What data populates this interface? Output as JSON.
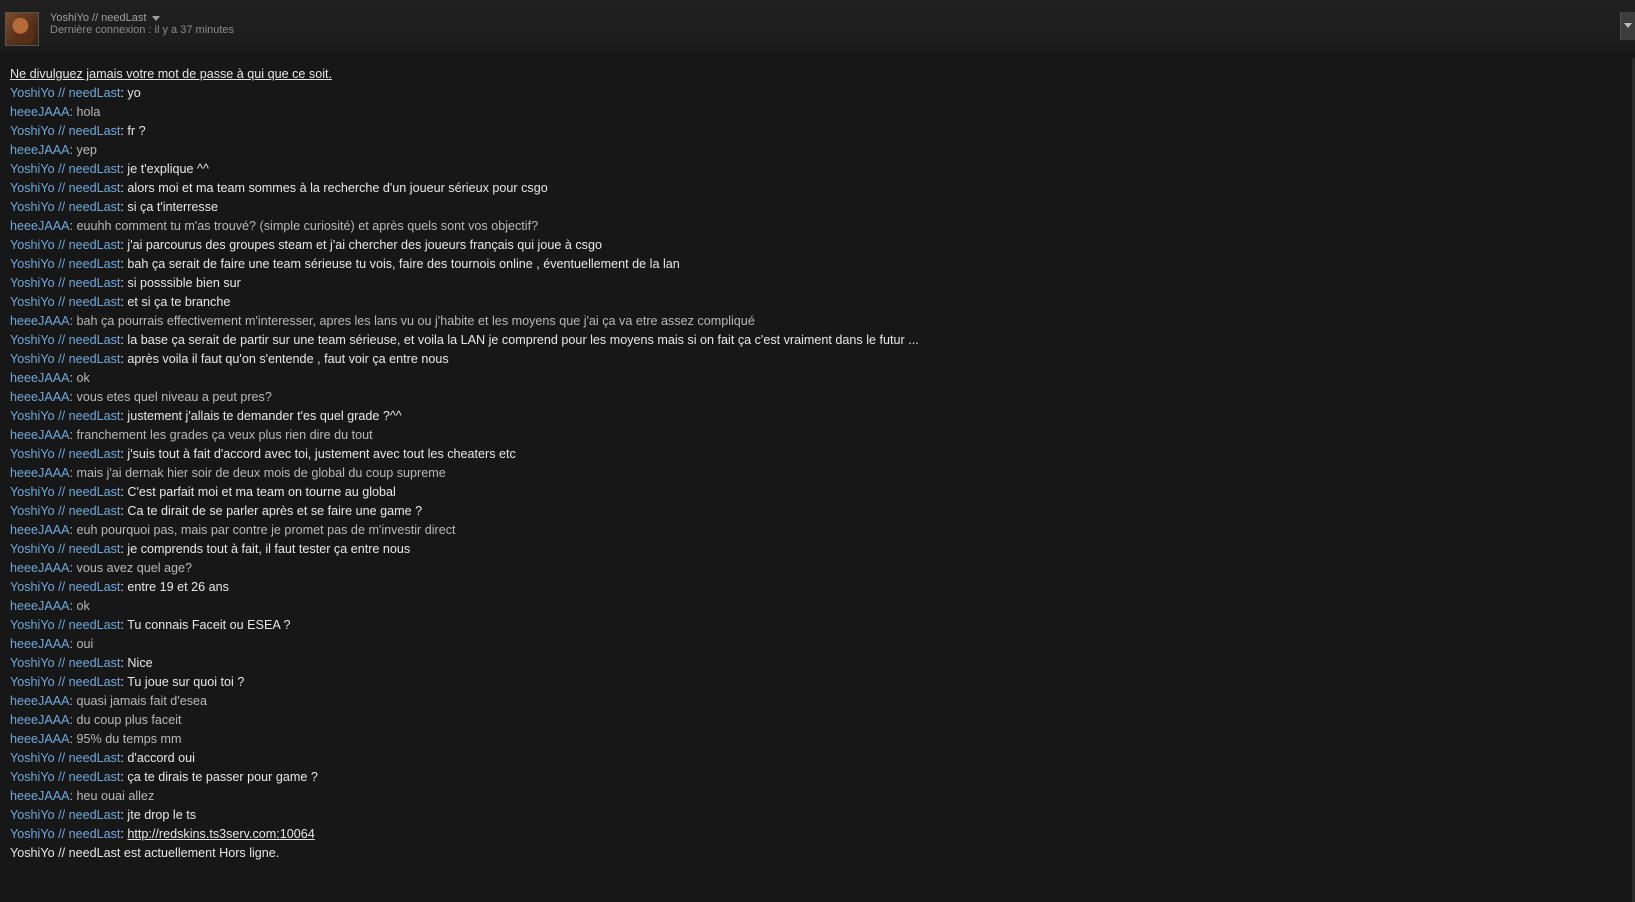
{
  "header": {
    "persona_name": "YoshiYo // needLast",
    "last_seen": "Dernière connexion : il y a 37 minutes"
  },
  "chat": {
    "warning": "Ne divulguez jamais votre mot de passe à qui que ce soit.",
    "messages": [
      {
        "sender": "YoshiYo // needLast",
        "self": true,
        "text": "yo"
      },
      {
        "sender": "heeeJAAA",
        "self": false,
        "text": "hola"
      },
      {
        "sender": "YoshiYo // needLast",
        "self": true,
        "text": "fr ?"
      },
      {
        "sender": "heeeJAAA",
        "self": false,
        "text": "yep"
      },
      {
        "sender": "YoshiYo // needLast",
        "self": true,
        "text": "je t'explique ^^"
      },
      {
        "sender": "YoshiYo // needLast",
        "self": true,
        "text": "alors moi et ma team sommes à la recherche d'un joueur sérieux pour csgo"
      },
      {
        "sender": "YoshiYo // needLast",
        "self": true,
        "text": "si ça t'interresse"
      },
      {
        "sender": "heeeJAAA",
        "self": false,
        "text": "euuhh comment tu m'as trouvé? (simple curiosité) et après quels sont vos objectif?"
      },
      {
        "sender": "YoshiYo // needLast",
        "self": true,
        "text": "j'ai parcourus des groupes steam et j'ai chercher des joueurs français qui joue à csgo"
      },
      {
        "sender": "YoshiYo // needLast",
        "self": true,
        "text": "bah ça serait de faire une team sérieuse tu vois, faire des tournois online , éventuellement de la lan"
      },
      {
        "sender": "YoshiYo // needLast",
        "self": true,
        "text": "si posssible bien sur"
      },
      {
        "sender": "YoshiYo // needLast",
        "self": true,
        "text": "et si ça te branche"
      },
      {
        "sender": "heeeJAAA",
        "self": false,
        "text": "bah ça pourrais effectivement m'interesser, apres les lans vu ou j'habite et les moyens que j'ai ça va etre assez compliqué"
      },
      {
        "sender": "YoshiYo // needLast",
        "self": true,
        "text": "la base ça serait de partir sur une team sérieuse, et voila la LAN je comprend pour les moyens mais si on fait ça c'est vraiment dans le futur ..."
      },
      {
        "sender": "YoshiYo // needLast",
        "self": true,
        "text": "après voila il faut qu'on s'entende , faut voir ça entre nous"
      },
      {
        "sender": "heeeJAAA",
        "self": false,
        "text": "ok"
      },
      {
        "sender": "heeeJAAA",
        "self": false,
        "text": "vous etes quel niveau a peut pres?"
      },
      {
        "sender": "YoshiYo // needLast",
        "self": true,
        "text": "justement j'allais te demander t'es quel grade ?^^"
      },
      {
        "sender": "heeeJAAA",
        "self": false,
        "text": "franchement les grades ça veux plus rien dire du tout"
      },
      {
        "sender": "YoshiYo // needLast",
        "self": true,
        "text": "j'suis tout à fait d'accord avec toi, justement avec tout les cheaters etc"
      },
      {
        "sender": "heeeJAAA",
        "self": false,
        "text": "mais j'ai dernak hier soir de deux mois de global du coup supreme"
      },
      {
        "sender": "YoshiYo // needLast",
        "self": true,
        "text": "C'est parfait moi et ma team on tourne au global"
      },
      {
        "sender": "YoshiYo // needLast",
        "self": true,
        "text": "Ca te dirait de se parler après et se faire une game ?"
      },
      {
        "sender": "heeeJAAA",
        "self": false,
        "text": "euh pourquoi pas, mais par contre je promet pas de m'investir direct"
      },
      {
        "sender": "YoshiYo // needLast",
        "self": true,
        "text": "je comprends tout à fait, il faut tester ça entre nous"
      },
      {
        "sender": "heeeJAAA",
        "self": false,
        "text": "vous avez quel age?"
      },
      {
        "sender": "YoshiYo // needLast",
        "self": true,
        "text": "entre 19 et 26 ans"
      },
      {
        "sender": "heeeJAAA",
        "self": false,
        "text": "ok"
      },
      {
        "sender": "YoshiYo // needLast",
        "self": true,
        "text": "Tu connais Faceit ou ESEA ?"
      },
      {
        "sender": "heeeJAAA",
        "self": false,
        "text": "oui"
      },
      {
        "sender": "YoshiYo // needLast",
        "self": true,
        "text": "Nice"
      },
      {
        "sender": "YoshiYo // needLast",
        "self": true,
        "text": "Tu joue sur quoi toi ?"
      },
      {
        "sender": "heeeJAAA",
        "self": false,
        "text": "quasi jamais fait d'esea"
      },
      {
        "sender": "heeeJAAA",
        "self": false,
        "text": "du coup plus faceit"
      },
      {
        "sender": "heeeJAAA",
        "self": false,
        "text": "95% du temps mm"
      },
      {
        "sender": "YoshiYo // needLast",
        "self": true,
        "text": "d'accord oui"
      },
      {
        "sender": "YoshiYo // needLast",
        "self": true,
        "text": "ça te dirais te passer pour game ?"
      },
      {
        "sender": "heeeJAAA",
        "self": false,
        "text": "heu ouai allez"
      },
      {
        "sender": "YoshiYo // needLast",
        "self": true,
        "text": "jte drop le ts"
      },
      {
        "sender": "YoshiYo // needLast",
        "self": true,
        "text": "http://redskins.ts3serv.com:10064",
        "is_link": true
      }
    ],
    "status_line": "YoshiYo // needLast est actuellement Hors ligne."
  }
}
